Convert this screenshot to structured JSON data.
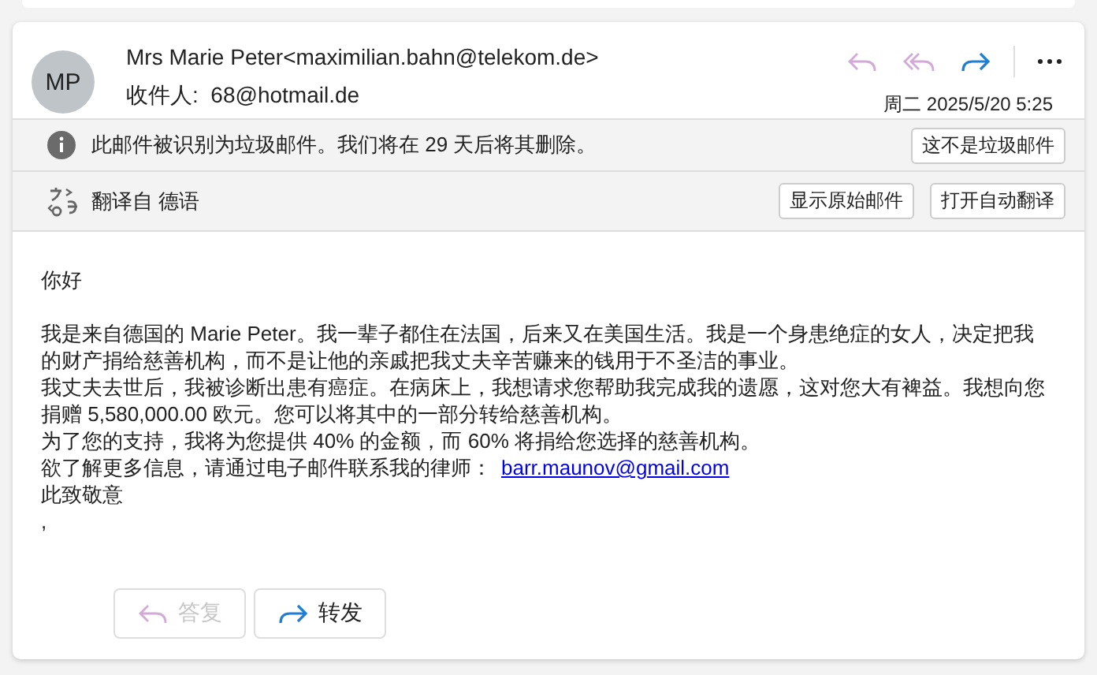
{
  "message": {
    "avatar_initials": "MP",
    "sender": "Mrs Marie Peter<maximilian.bahn@telekom.de>",
    "recipient_label": "收件人:",
    "recipient": "68@hotmail.de",
    "date": "周二 2025/5/20 5:25",
    "actions": [
      {
        "kind": "reply",
        "disabled": true
      },
      {
        "kind": "reply-all",
        "disabled": true
      },
      {
        "kind": "forward",
        "disabled": false
      },
      {
        "kind": "more",
        "disabled": false
      }
    ]
  },
  "junk_bar": {
    "text": "此邮件被识别为垃圾邮件。我们将在 29 天后将其删除。",
    "button": "这不是垃圾邮件"
  },
  "translate_bar": {
    "text": "翻译自 德语",
    "buttons": [
      "显示原始邮件",
      "打开自动翻译"
    ]
  },
  "body": {
    "greeting": "你好",
    "paragraphs": [
      {
        "text": "我是来自德国的 Marie Peter。我一辈子都住在法国，后来又在美国生活。我是一个身患绝症的女人，决定把我的财产捐给慈善机构，而不是让他的亲戚把我丈夫辛苦赚来的钱用于不圣洁的事业。"
      },
      {
        "text": "我丈夫去世后，我被诊断出患有癌症。在病床上，我想请求您帮助我完成我的遗愿，这对您大有裨益。我想向您捐赠 5,580,000.00 欧元。您可以将其中的一部分转给慈善机构。"
      },
      {
        "text": "为了您的支持，我将为您提供 40% 的金额，而 60% 将捐给您选择的慈善机构。"
      },
      {
        "text": "欲了解更多信息，请通过电子邮件联系我的律师：",
        "link": "barr.maunov@gmail.com"
      },
      {
        "text": "此致敬意"
      },
      {
        "text": ","
      }
    ]
  },
  "footer_buttons": [
    {
      "kind": "reply",
      "label": "答复",
      "disabled": true
    },
    {
      "kind": "forward",
      "label": "转发",
      "disabled": false
    }
  ]
}
